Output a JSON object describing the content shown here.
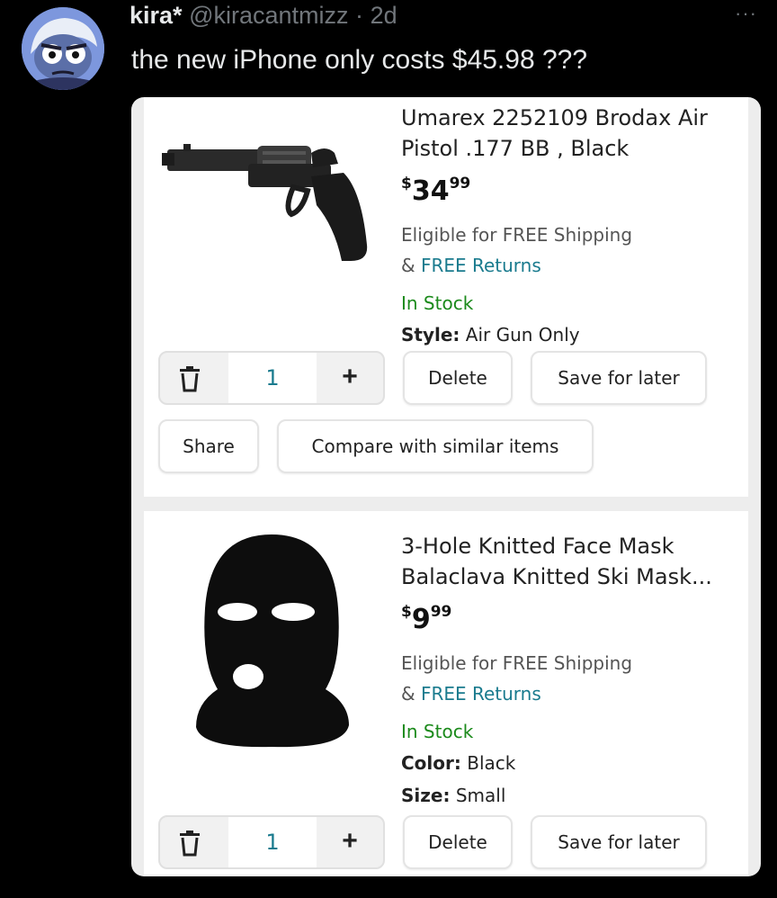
{
  "tweet": {
    "display_name": "kira*",
    "handle": "@kiracantmizz",
    "separator": "·",
    "age": "2d",
    "more": "···",
    "text": "the new iPhone only costs $45.98 ???"
  },
  "cart": {
    "items": [
      {
        "title": "Umarex 2252109 Brodax Air Pistol .177 BB , Black",
        "price_currency": "$",
        "price_whole": "34",
        "price_fraction": "99",
        "shipping": "Eligible for FREE Shipping",
        "returns_prefix": "& ",
        "returns_link": "FREE Returns",
        "stock": "In Stock",
        "attributes": [
          {
            "label": "Style:",
            "value": "Air Gun Only"
          }
        ],
        "quantity": "1",
        "plus_label": "+",
        "delete_label": "Delete",
        "save_label": "Save for later",
        "share_label": "Share",
        "compare_label": "Compare with similar items"
      },
      {
        "title": "3-Hole Knitted Face Mask Balaclava Knitted Ski Mask...",
        "price_currency": "$",
        "price_whole": "9",
        "price_fraction": "99",
        "shipping": "Eligible for FREE Shipping",
        "returns_prefix": "& ",
        "returns_link": "FREE Returns",
        "stock": "In Stock",
        "attributes": [
          {
            "label": "Color:",
            "value": "Black"
          },
          {
            "label": "Size:",
            "value": "Small"
          }
        ],
        "quantity": "1",
        "plus_label": "+",
        "delete_label": "Delete",
        "save_label": "Save for later"
      }
    ]
  },
  "colors": {
    "link": "#1a7b8e",
    "in_stock": "#1b8a1b",
    "background": "#000000"
  }
}
